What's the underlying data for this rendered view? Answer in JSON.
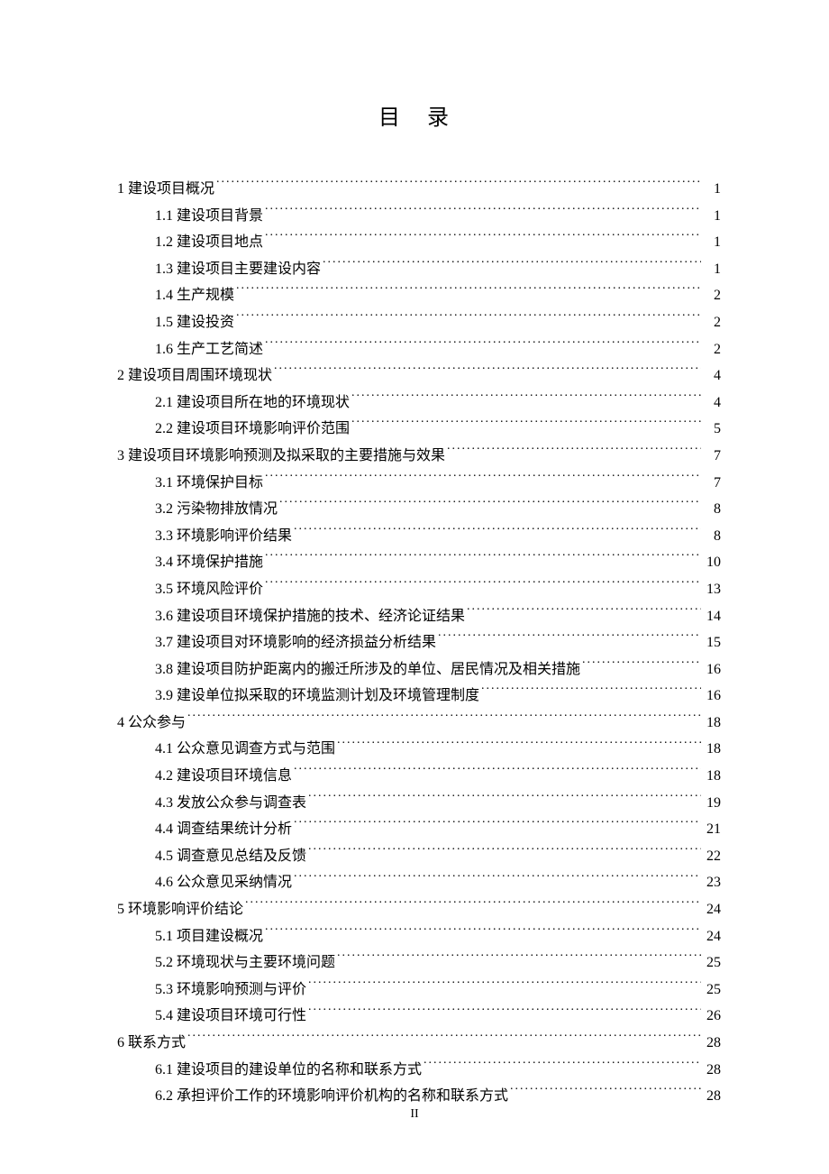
{
  "title": "目 录",
  "pageNumber": "II",
  "toc": [
    {
      "level": 1,
      "label": "1 建设项目概况",
      "page": "1"
    },
    {
      "level": 2,
      "label": "1.1 建设项目背景",
      "page": "1"
    },
    {
      "level": 2,
      "label": "1.2 建设项目地点",
      "page": "1"
    },
    {
      "level": 2,
      "label": "1.3 建设项目主要建设内容",
      "page": "1"
    },
    {
      "level": 2,
      "label": "1.4 生产规模",
      "page": "2"
    },
    {
      "level": 2,
      "label": "1.5 建设投资",
      "page": "2"
    },
    {
      "level": 2,
      "label": "1.6 生产工艺简述",
      "page": "2"
    },
    {
      "level": 1,
      "label": "2  建设项目周围环境现状",
      "page": "4"
    },
    {
      "level": 2,
      "label": "2.1 建设项目所在地的环境现状",
      "page": "4"
    },
    {
      "level": 2,
      "label": "2.2 建设项目环境影响评价范围",
      "page": "5"
    },
    {
      "level": 1,
      "label": "3 建设项目环境影响预测及拟采取的主要措施与效果",
      "page": "7"
    },
    {
      "level": 2,
      "label": "3.1 环境保护目标",
      "page": "7"
    },
    {
      "level": 2,
      "label": "3.2 污染物排放情况",
      "page": "8"
    },
    {
      "level": 2,
      "label": "3.3 环境影响评价结果",
      "page": "8"
    },
    {
      "level": 2,
      "label": "3.4 环境保护措施",
      "page": "10"
    },
    {
      "level": 2,
      "label": "3.5 环境风险评价",
      "page": "13"
    },
    {
      "level": 2,
      "label": "3.6 建设项目环境保护措施的技术、经济论证结果",
      "page": "14"
    },
    {
      "level": 2,
      "label": "3.7 建设项目对环境影响的经济损益分析结果",
      "page": "15"
    },
    {
      "level": 2,
      "label": "3.8 建设项目防护距离内的搬迁所涉及的单位、居民情况及相关措施",
      "page": "16"
    },
    {
      "level": 2,
      "label": "3.9 建设单位拟采取的环境监测计划及环境管理制度",
      "page": "16"
    },
    {
      "level": 1,
      "label": "4 公众参与",
      "page": "18"
    },
    {
      "level": 2,
      "label": "4.1 公众意见调查方式与范围",
      "page": "18"
    },
    {
      "level": 2,
      "label": "4.2 建设项目环境信息",
      "page": "18"
    },
    {
      "level": 2,
      "label": "4.3  发放公众参与调查表",
      "page": "19"
    },
    {
      "level": 2,
      "label": "4.4  调查结果统计分析",
      "page": "21"
    },
    {
      "level": 2,
      "label": "4.5  调查意见总结及反馈",
      "page": "22"
    },
    {
      "level": 2,
      "label": "4.6 公众意见采纳情况",
      "page": "23"
    },
    {
      "level": 1,
      "label": "5 环境影响评价结论",
      "page": "24"
    },
    {
      "level": 2,
      "label": "5.1 项目建设概况",
      "page": "24"
    },
    {
      "level": 2,
      "label": "5.2 环境现状与主要环境问题",
      "page": "25"
    },
    {
      "level": 2,
      "label": "5.3 环境影响预测与评价",
      "page": "25"
    },
    {
      "level": 2,
      "label": "5.4 建设项目环境可行性",
      "page": "26"
    },
    {
      "level": 1,
      "label": "6 联系方式",
      "page": "28"
    },
    {
      "level": 2,
      "label": "6.1 建设项目的建设单位的名称和联系方式",
      "page": "28"
    },
    {
      "level": 2,
      "label": "6.2 承担评价工作的环境影响评价机构的名称和联系方式",
      "page": "28"
    }
  ]
}
